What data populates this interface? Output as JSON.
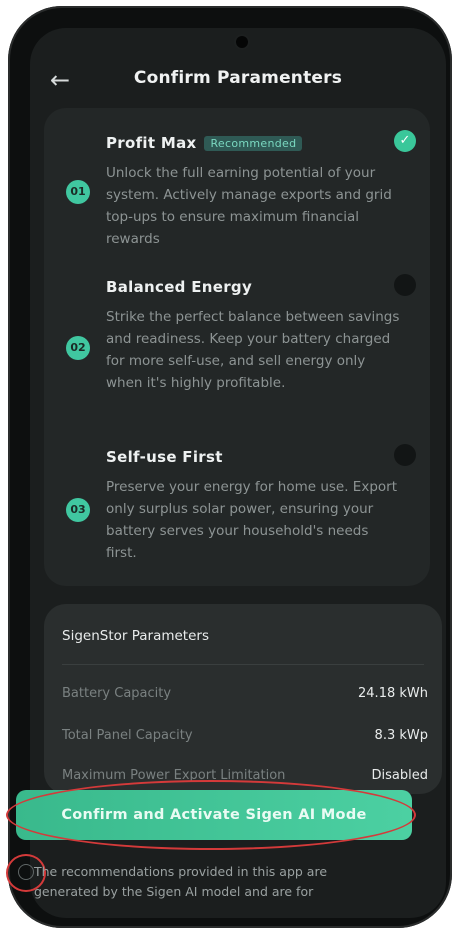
{
  "header": {
    "back_icon": "arrow-left-icon",
    "title": "Confirm Paramenters"
  },
  "strategies": [
    {
      "num": "01",
      "title": "Profit Max",
      "badge": "Recommended",
      "desc": "Unlock the full earning potential of your system. Actively manage exports and grid top-ups to ensure maximum financial rewards",
      "selected": true
    },
    {
      "num": "02",
      "title": "Balanced Energy",
      "badge": "",
      "desc": "Strike the perfect balance between savings and readiness. Keep your battery charged for more self-use, and sell energy only when it's highly profitable.",
      "selected": false
    },
    {
      "num": "03",
      "title": "Self-use First",
      "badge": "",
      "desc": "Preserve your energy for home use. Export only surplus solar power, ensuring your battery serves your household's needs first.",
      "selected": false
    }
  ],
  "params": {
    "title": "SigenStor Parameters",
    "rows": [
      {
        "label": "Battery Capacity",
        "value": "24.18 kWh"
      },
      {
        "label": "Total Panel Capacity",
        "value": "8.3 kWp"
      },
      {
        "label": "Maximum Power Export Limitation",
        "value": "Disabled"
      }
    ]
  },
  "cta": {
    "label": "Confirm and Activate Sigen AI Mode"
  },
  "disclaimer": {
    "text": "The recommendations provided in this app are generated by the Sigen AI model and are for"
  },
  "colors": {
    "accent": "#40c7a0",
    "highlight": "#d43a3a",
    "background": "#1b1e1e"
  }
}
